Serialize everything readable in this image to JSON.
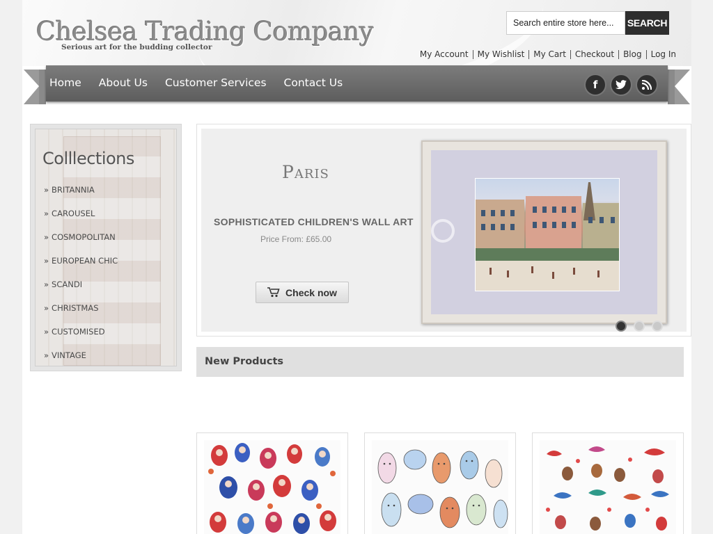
{
  "header": {
    "logo_title": "Chelsea Trading Company",
    "logo_tagline": "Serious art for the budding collector",
    "search": {
      "placeholder": "Search entire store here...",
      "button": "SEARCH"
    },
    "account_links": [
      "My Account",
      "My Wishlist",
      "My Cart",
      "Checkout",
      "Blog",
      "Log In"
    ]
  },
  "nav": {
    "items": [
      "Home",
      "About Us",
      "Customer Services",
      "Contact Us"
    ],
    "social": [
      {
        "icon": "facebook-icon",
        "glyph": "f"
      },
      {
        "icon": "twitter-icon",
        "glyph": "t"
      },
      {
        "icon": "rss-icon",
        "glyph": "≋"
      }
    ]
  },
  "sidebar": {
    "title": "Colllections",
    "bullet": "»",
    "items": [
      "BRITANNIA",
      "CAROUSEL",
      "COSMOPOLITAN",
      "EUROPEAN CHIC",
      "SCANDI",
      "CHRISTMAS",
      "CUSTOMISED",
      "VINTAGE"
    ]
  },
  "slider": {
    "title": "Paris",
    "subtitle": "SOPHISTICATED CHILDREN'S WALL ART",
    "price": "Price From: £65.00",
    "button": "Check now",
    "slide_count": 3,
    "active_slide": 1
  },
  "new_products": {
    "title": "New Products"
  },
  "colors": {
    "nav_bg": "#6b6b6b",
    "search_button": "#2e2e2e",
    "section_bar": "#e0e0e0"
  }
}
